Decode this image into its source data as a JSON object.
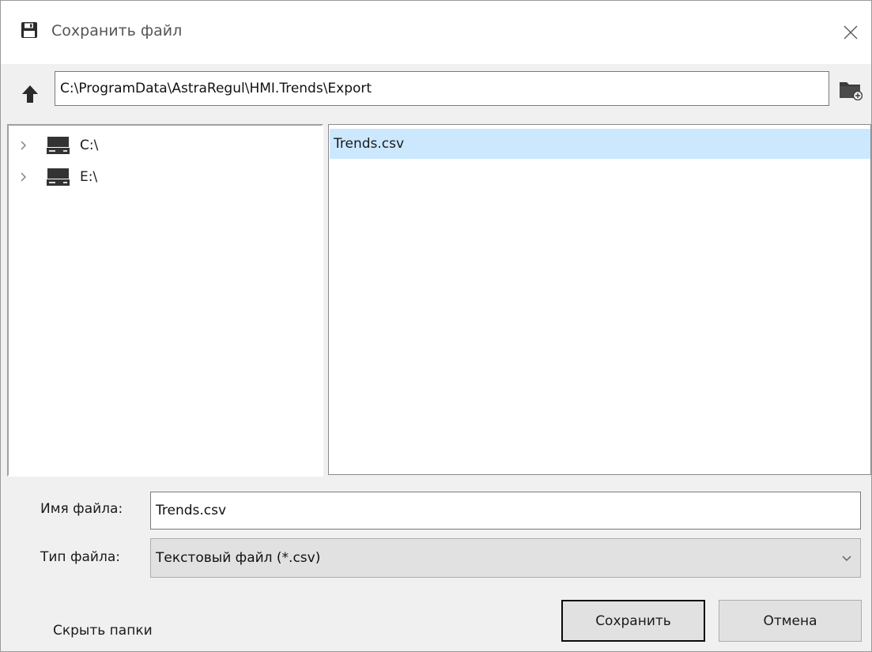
{
  "window": {
    "title": "Сохранить файл",
    "title_icon": "save-icon",
    "close_icon": "close-icon"
  },
  "toolbar": {
    "up_icon": "arrow-up-icon",
    "path": "C:\\ProgramData\\AstraRegul\\HMI.Trends\\Export",
    "new_folder_icon": "new-folder-icon"
  },
  "tree": {
    "items": [
      {
        "label": "C:\\",
        "icon": "drive-icon"
      },
      {
        "label": "E:\\",
        "icon": "drive-icon"
      }
    ]
  },
  "files": {
    "items": [
      {
        "name": "Trends.csv",
        "selected": true
      }
    ]
  },
  "form": {
    "filename_label": "Имя файла:",
    "filename_value": "Trends.csv",
    "filetype_label": "Тип файла:",
    "filetype_value": "Текстовый файл (*.csv)"
  },
  "footer": {
    "hide_folders": "Скрыть папки",
    "save_label": "Сохранить",
    "cancel_label": "Отмена"
  },
  "colors": {
    "selection": "#cce8ff",
    "dialog_bg": "#f0f0f0",
    "button_bg": "#e1e1e1",
    "icon": "#2b2b2b"
  }
}
